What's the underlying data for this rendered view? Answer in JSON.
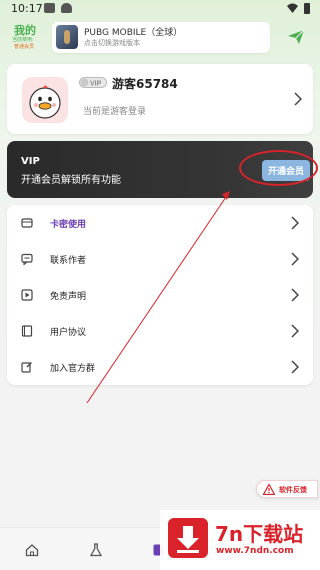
{
  "status_bar": {
    "time": "10:17"
  },
  "header": {
    "title": "我的",
    "sub_line1": "当前使用:",
    "sub_line2": "普通会员",
    "game": {
      "name": "PUBG MOBILE（全球）",
      "hint": "点击切换游戏版本"
    }
  },
  "user": {
    "badge": "VIP",
    "name": "游客65784",
    "status": "当前是游客登录"
  },
  "vip": {
    "title": "VIP",
    "description": "开通会员解锁所有功能",
    "button_label": "开通会员"
  },
  "menu": {
    "items": [
      {
        "label": "卡密使用",
        "icon": "card-key-icon",
        "highlight": true
      },
      {
        "label": "联系作者",
        "icon": "chat-icon",
        "highlight": false
      },
      {
        "label": "免责声明",
        "icon": "play-doc-icon",
        "highlight": false
      },
      {
        "label": "用户协议",
        "icon": "book-icon",
        "highlight": false
      },
      {
        "label": "加入官方群",
        "icon": "edit-icon",
        "highlight": false
      }
    ]
  },
  "feedback": {
    "label": "软件反馈"
  },
  "bottom_nav": {
    "items": [
      "home-icon",
      "flask-icon",
      "profile-icon"
    ]
  },
  "watermark": {
    "title": "7n下载站",
    "url": "www.7ndn.com"
  },
  "colors": {
    "accent_green": "#4caf50",
    "purple": "#6b3fb3",
    "annotation_red": "#d9222a",
    "vip_button": "#8ab6e0"
  }
}
